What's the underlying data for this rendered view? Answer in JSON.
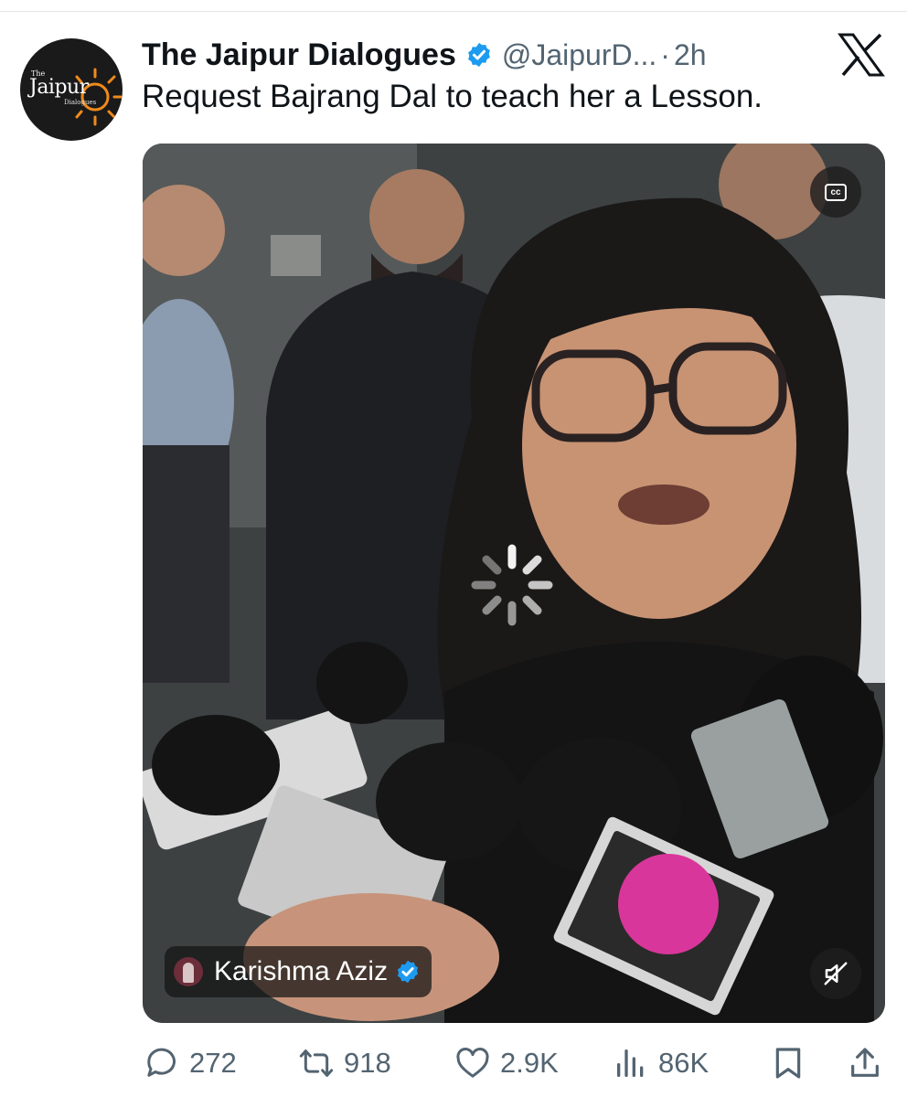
{
  "tweet": {
    "avatar_text_small": "The",
    "avatar_text_main": "Jaipur",
    "avatar_text_sub": "Dialogues",
    "display_name": "The Jaipur Dialogues",
    "verified_icon": "blue-check-badge",
    "handle": "@JaipurD...",
    "separator": "·",
    "time": "2h",
    "text": "Request Bajrang Dal to teach her a Lesson."
  },
  "media": {
    "type": "video",
    "state": "loading",
    "cc_label": "cc",
    "attribution_name": "Karishma Aziz",
    "muted": true
  },
  "actions": {
    "reply_count": "272",
    "repost_count": "918",
    "like_count": "2.9K",
    "views_count": "86K"
  },
  "colors": {
    "verified_blue": "#1d9bf0",
    "muted_text": "#536471",
    "text": "#0f1419"
  }
}
